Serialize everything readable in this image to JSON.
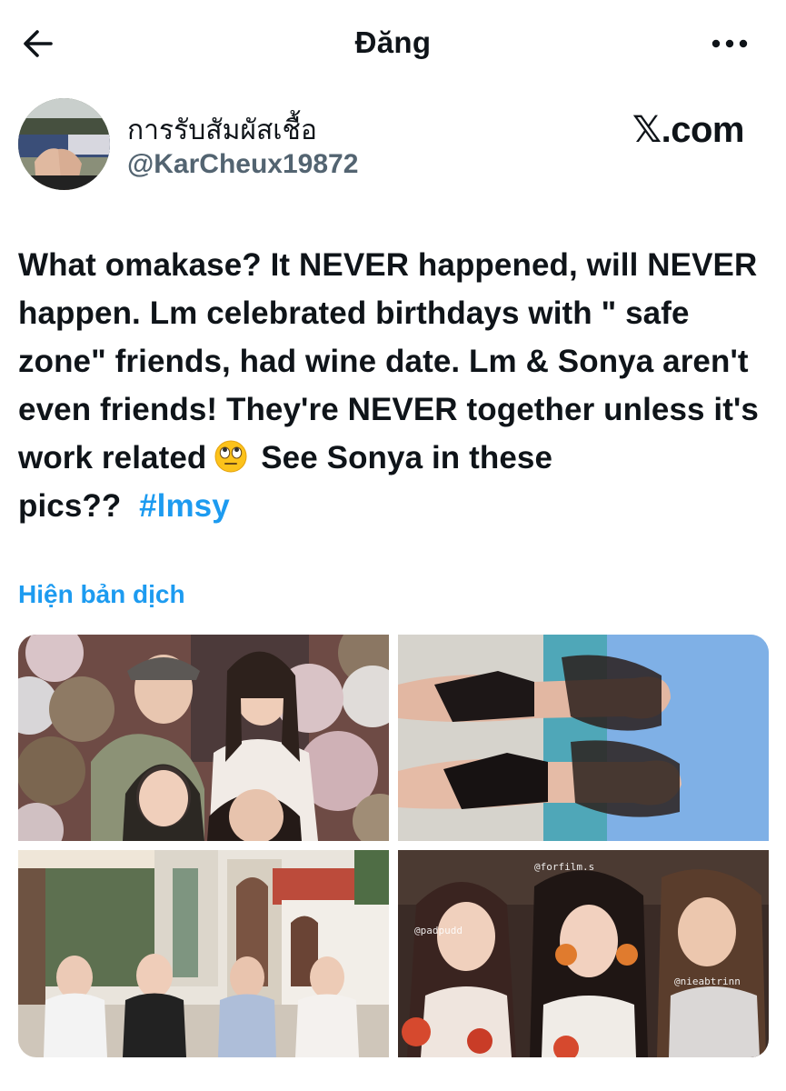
{
  "header": {
    "title": "Đăng",
    "back_icon": "arrow-left-icon",
    "more_icon": "more-horizontal-icon"
  },
  "author": {
    "display_name": "การรับสัมผัสเชื้อ",
    "handle": "@KarCheux19872",
    "source_label": "𝕏.com"
  },
  "tweet": {
    "text_parts": [
      "What omakase? It NEVER happened, will NEVER happen. Lm celebrated birthdays with \" safe zone\" friends, had wine date. Lm & Sonya aren't even friends! They're NEVER together unless it's work related",
      "See Sonya in these pics??"
    ],
    "emoji": "face-with-rolling-eyes",
    "hashtag": "#lmsy",
    "translate_label": "Hiện bản dịch"
  },
  "media": {
    "count": 4,
    "watermarks": [
      "@forfilm.s",
      "@padpudd",
      "@nieabtrinn"
    ]
  },
  "colors": {
    "link": "#1d9bf0",
    "text": "#0f1419",
    "secondary": "#536471"
  }
}
